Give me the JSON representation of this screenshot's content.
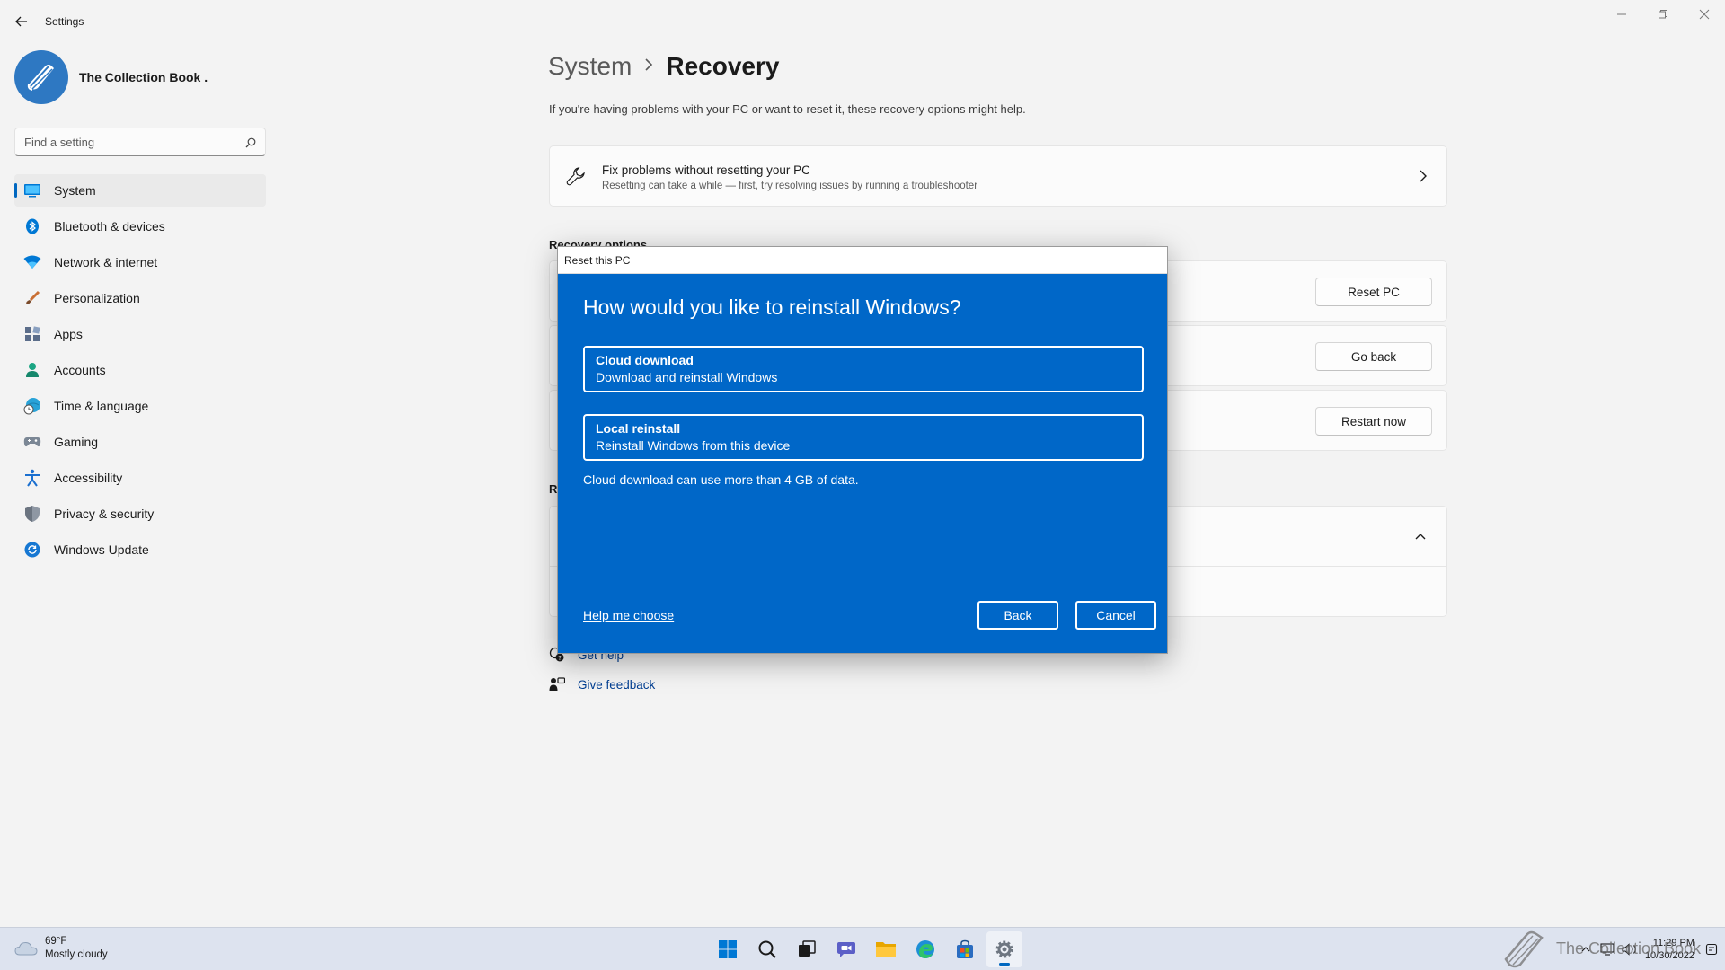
{
  "window": {
    "title": "Settings",
    "controls": {
      "minimize": "—",
      "restore": "❐",
      "close": "✕"
    }
  },
  "profile": {
    "name": "The Collection Book ."
  },
  "search": {
    "placeholder": "Find a setting"
  },
  "sidebar": {
    "items": [
      {
        "label": "System",
        "icon": "monitor-icon",
        "active": true
      },
      {
        "label": "Bluetooth & devices",
        "icon": "bluetooth-icon"
      },
      {
        "label": "Network & internet",
        "icon": "wifi-icon"
      },
      {
        "label": "Personalization",
        "icon": "brush-icon"
      },
      {
        "label": "Apps",
        "icon": "apps-icon"
      },
      {
        "label": "Accounts",
        "icon": "person-icon"
      },
      {
        "label": "Time & language",
        "icon": "globe-clock-icon"
      },
      {
        "label": "Gaming",
        "icon": "gamepad-icon"
      },
      {
        "label": "Accessibility",
        "icon": "accessibility-icon"
      },
      {
        "label": "Privacy & security",
        "icon": "shield-icon"
      },
      {
        "label": "Windows Update",
        "icon": "update-icon"
      }
    ]
  },
  "main": {
    "breadcrumb": {
      "parent": "System",
      "current": "Recovery"
    },
    "subtitle": "If you're having problems with your PC or want to reset it, these recovery options might help.",
    "fix_card": {
      "title": "Fix problems without resetting your PC",
      "description": "Resetting can take a while — first, try resolving issues by running a troubleshooter"
    },
    "recovery_options_heading": "Recovery options",
    "options": [
      {
        "button": "Reset PC"
      },
      {
        "button": "Go back"
      },
      {
        "button": "Restart now"
      }
    ],
    "related_heading": "R",
    "help": [
      {
        "label": "Get help",
        "icon": "help-icon"
      },
      {
        "label": "Give feedback",
        "icon": "feedback-icon"
      }
    ]
  },
  "dialog": {
    "title": "Reset this PC",
    "heading": "How would you like to reinstall Windows?",
    "options": [
      {
        "title": "Cloud download",
        "description": "Download and reinstall Windows"
      },
      {
        "title": "Local reinstall",
        "description": "Reinstall Windows from this device"
      }
    ],
    "note": "Cloud download can use more than 4 GB of data.",
    "help_link": "Help me choose",
    "back_button": "Back",
    "cancel_button": "Cancel"
  },
  "taskbar": {
    "weather": {
      "temp": "69°F",
      "condition": "Mostly cloudy"
    },
    "clock": {
      "time": "11:29 PM",
      "date": "10/30/2022"
    },
    "watermark": "The Collection Book",
    "apps": [
      "windows-start-icon",
      "search-icon",
      "task-view-icon",
      "chat-icon",
      "file-explorer-icon",
      "edge-icon",
      "store-icon",
      "settings-icon"
    ]
  },
  "colors": {
    "accent": "#0067c0",
    "dialog_background": "#0067c8",
    "page_background": "#f3f3f3"
  }
}
